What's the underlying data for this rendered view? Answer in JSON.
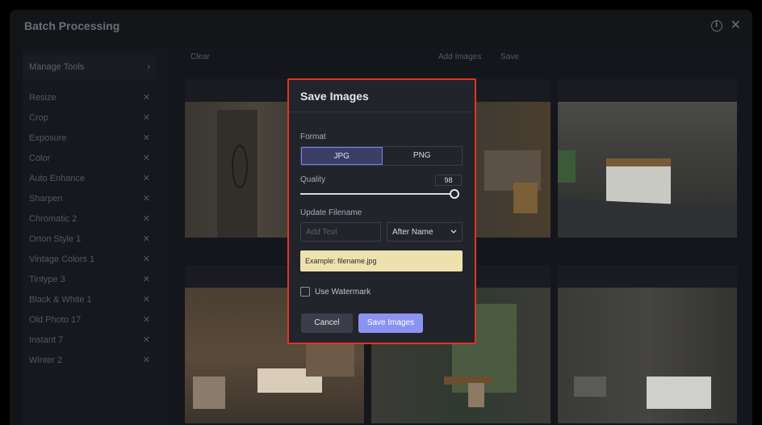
{
  "window": {
    "title": "Batch Processing",
    "info_icon": "info-icon",
    "close_icon": "close-icon"
  },
  "sidebar": {
    "manage_label": "Manage Tools",
    "manage_chevron": "›",
    "remove_glyph": "✕",
    "tools": [
      "Resize",
      "Crop",
      "Exposure",
      "Color",
      "Auto Enhance",
      "Sharpen",
      "Chromatic 2",
      "Orton Style 1",
      "Vintage Colors 1",
      "Tintype 3",
      "Black & White 1",
      "Old Photo 17",
      "Instant 7",
      "Winter 2"
    ]
  },
  "toolbar": {
    "clear_label": "Clear",
    "add_images_label": "Add Images",
    "save_label": "Save"
  },
  "dialog": {
    "title": "Save Images",
    "format_label": "Format",
    "formats": [
      "JPG",
      "PNG"
    ],
    "selected_format": "JPG",
    "quality_label": "Quality",
    "quality_value": "98",
    "quality_level": 0.98,
    "filename_label": "Update Filename",
    "filename_placeholder": "Add Text",
    "position_value": "After Name",
    "example_text": "Example: filename.jpg",
    "watermark_label": "Use Watermark",
    "watermark_checked": false,
    "cancel_label": "Cancel",
    "save_label": "Save Images"
  },
  "colors": {
    "accent": "#8b93f0",
    "highlight_border": "#e0361f",
    "example_bg": "#ede2ae"
  }
}
